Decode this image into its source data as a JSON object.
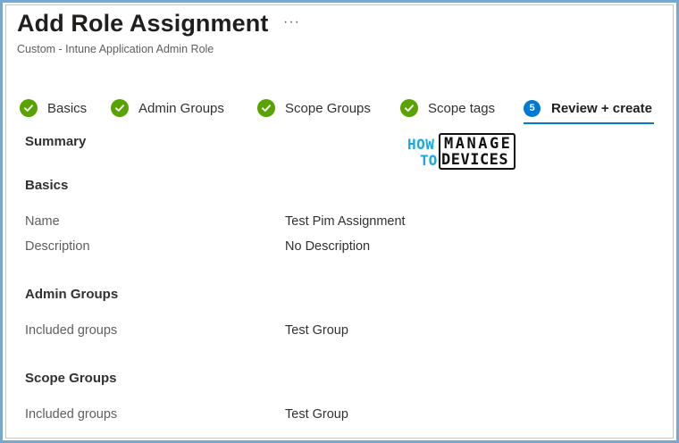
{
  "header": {
    "title": "Add Role Assignment",
    "more": "···",
    "subtitle": "Custom - Intune Application Admin Role"
  },
  "tabs": [
    {
      "label": "Basics",
      "status": "complete"
    },
    {
      "label": "Admin Groups",
      "status": "complete"
    },
    {
      "label": "Scope Groups",
      "status": "complete"
    },
    {
      "label": "Scope tags",
      "status": "complete"
    },
    {
      "label": "Review + create",
      "status": "active",
      "step": "5"
    }
  ],
  "summary": {
    "heading": "Summary"
  },
  "logo": {
    "how": "HOW",
    "to": "TO",
    "manage": "MANAGE",
    "devices": "DEVICES"
  },
  "basics": {
    "heading": "Basics",
    "rows": [
      {
        "label": "Name",
        "value": "Test Pim Assignment"
      },
      {
        "label": "Description",
        "value": "No Description"
      }
    ]
  },
  "admin_groups": {
    "heading": "Admin Groups",
    "rows": [
      {
        "label": "Included groups",
        "value": "Test Group"
      }
    ]
  },
  "scope_groups": {
    "heading": "Scope Groups",
    "rows": [
      {
        "label": "Included groups",
        "value": "Test Group"
      }
    ]
  },
  "colors": {
    "accent": "#0078d4",
    "success": "#57a300",
    "frame": "#7aa7cf"
  }
}
